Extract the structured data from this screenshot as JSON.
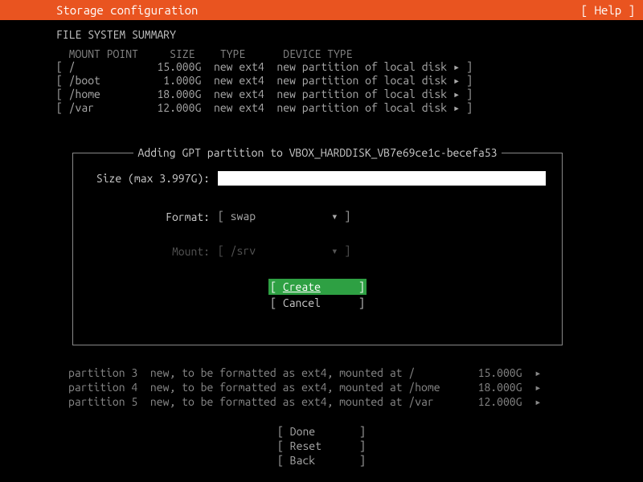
{
  "header": {
    "title": "Storage configuration",
    "help": "[ Help ]"
  },
  "summary": {
    "title": "FILE SYSTEM SUMMARY",
    "header_line": "  MOUNT POINT     SIZE    TYPE      DEVICE TYPE",
    "rows": [
      "[ /             15.000G  new ext4  new partition of local disk ▸ ]",
      "[ /boot          1.000G  new ext4  new partition of local disk ▸ ]",
      "[ /home         18.000G  new ext4  new partition of local disk ▸ ]",
      "[ /var          12.000G  new ext4  new partition of local disk ▸ ]"
    ]
  },
  "dialog": {
    "title": "Adding GPT partition to VBOX_HARDDISK_VB7e69ce1c-becefa53",
    "size_label": "Size (max 3.997G):",
    "format_label": "Format:",
    "format_select": "[ swap            ▾ ]",
    "mount_label": "Mount:",
    "mount_select": "[ /srv            ▾ ]",
    "create": "Create",
    "cancel": "[ Cancel      ]"
  },
  "pending": {
    "rows": [
      "partition 3  new, to be formatted as ext4, mounted at /          15.000G  ▸",
      "partition 4  new, to be formatted as ext4, mounted at /home      18.000G  ▸",
      "partition 5  new, to be formatted as ext4, mounted at /var       12.000G  ▸"
    ]
  },
  "footer": {
    "done": "[ Done       ]",
    "reset": "[ Reset      ]",
    "back": "[ Back       ]"
  }
}
